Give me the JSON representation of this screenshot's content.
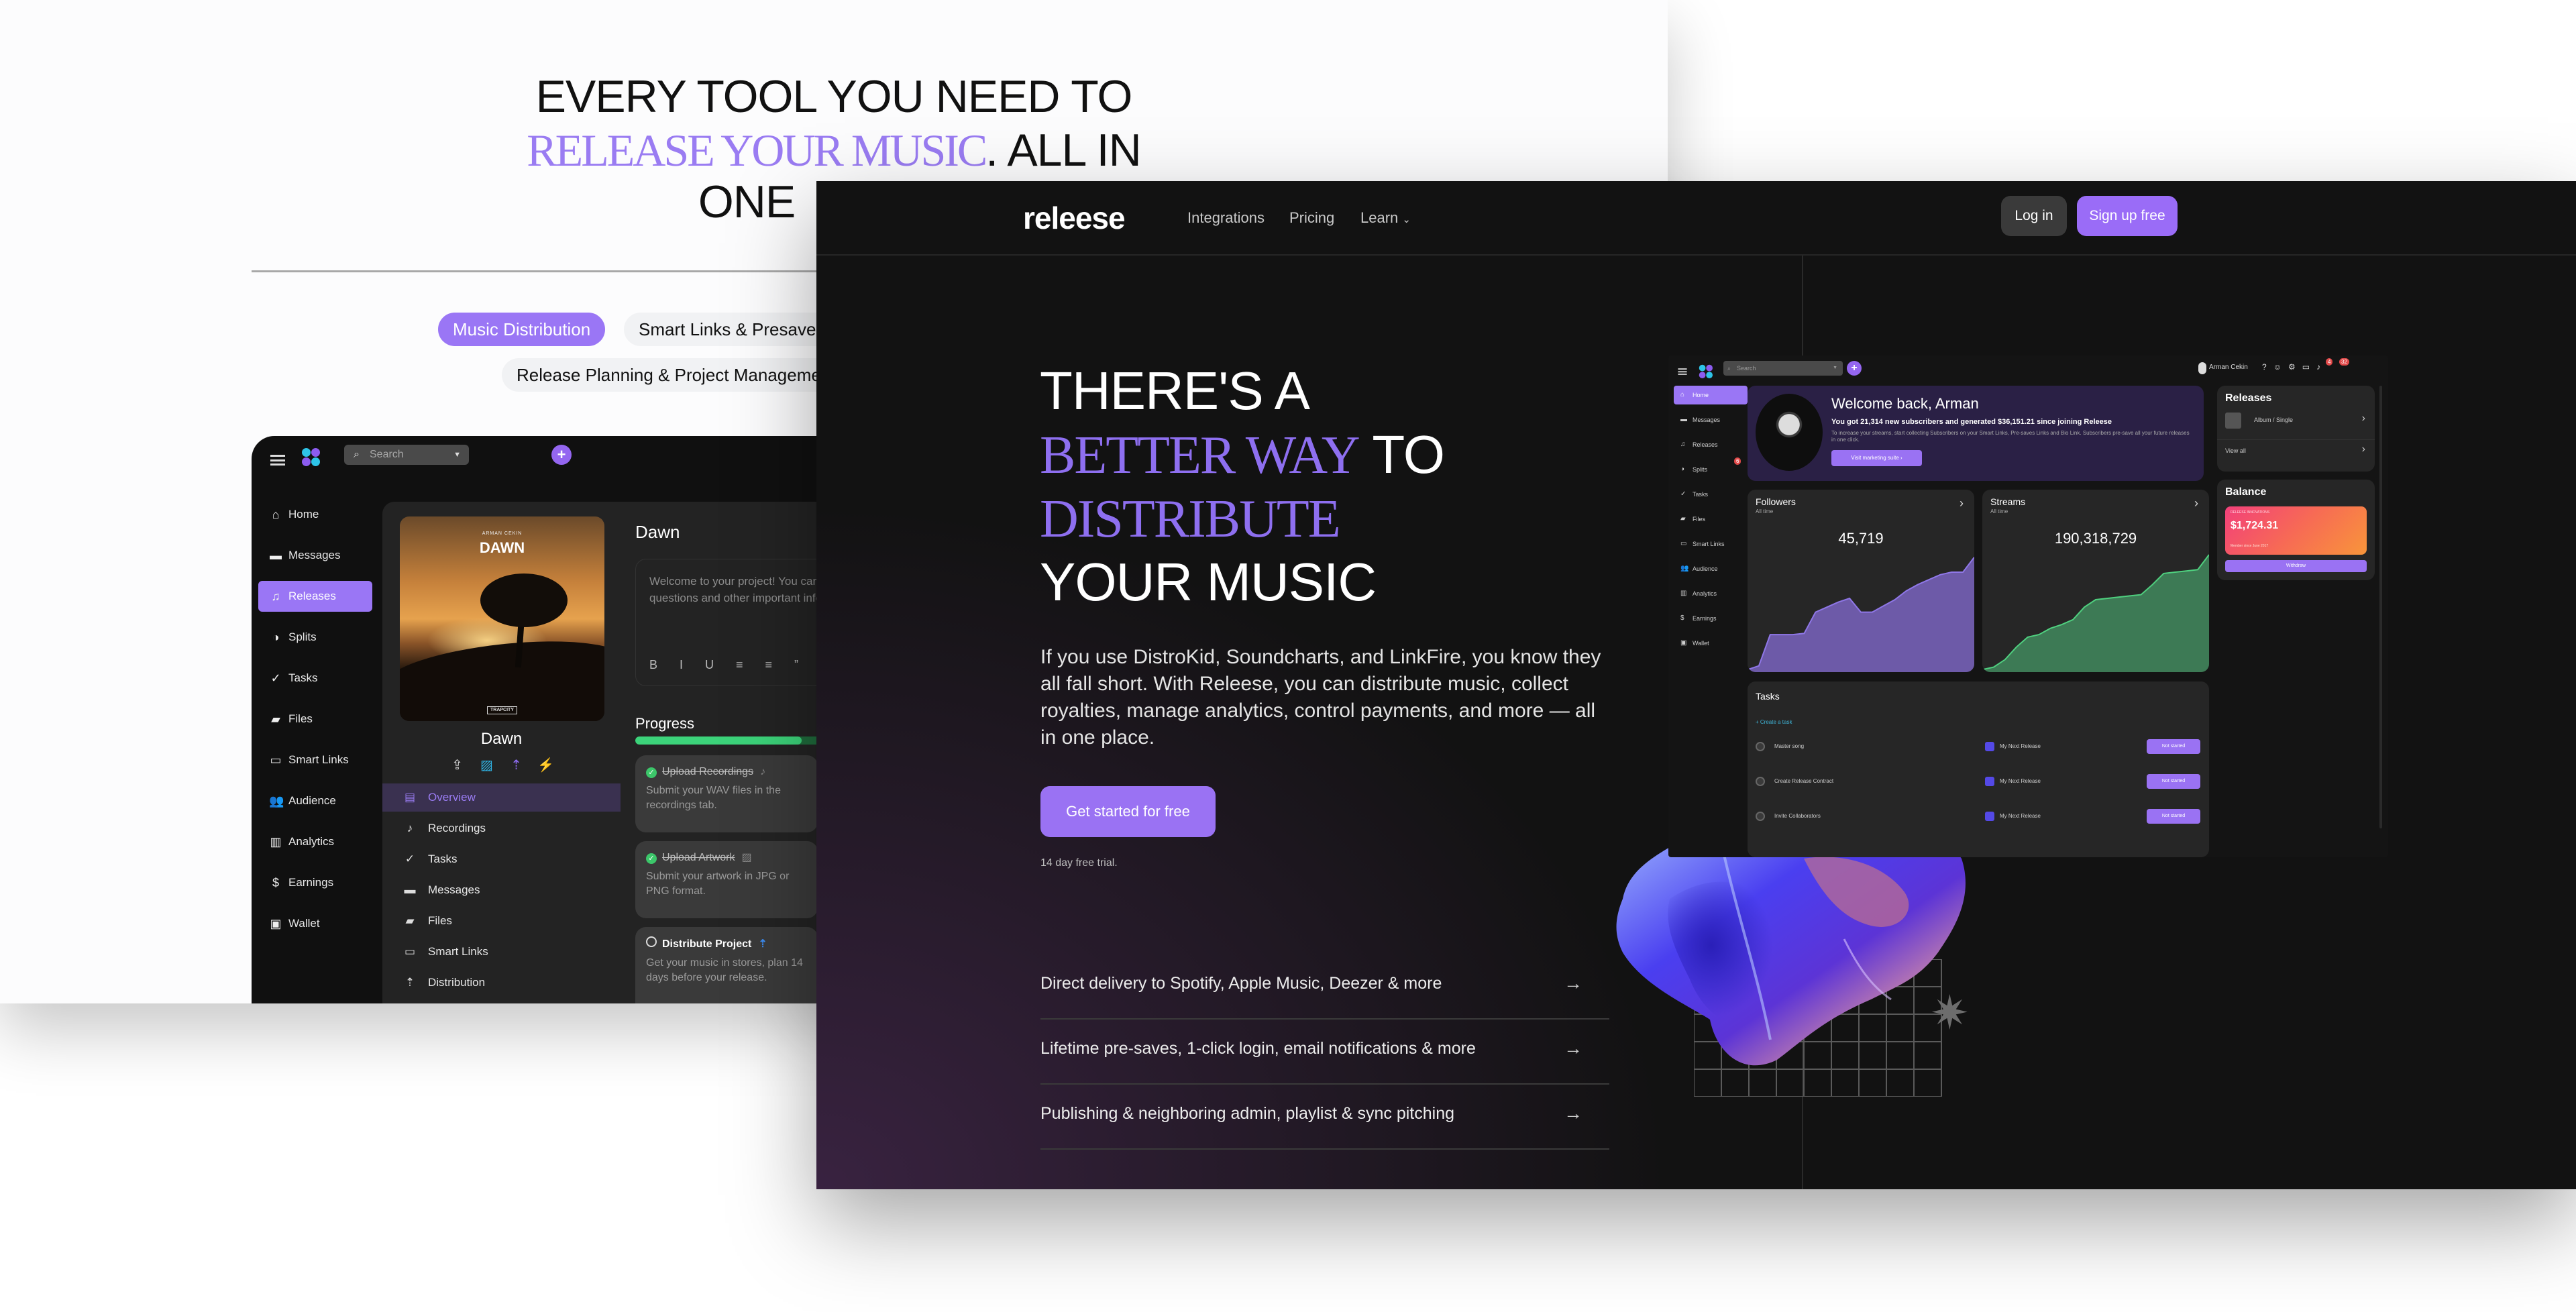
{
  "white_page": {
    "heading_line1": "EVERY TOOL YOU NEED TO",
    "heading_accent": "RELEASE YOUR MUSIC",
    "heading_line2_rest": ". ALL IN",
    "heading_line3": "ONE",
    "pills": [
      {
        "label": "Music Distribution",
        "active": true
      },
      {
        "label": "Smart Links & Presaves",
        "active": false
      },
      {
        "label": "Release Planning & Project Management",
        "active": false
      }
    ],
    "app": {
      "search_placeholder": "Search",
      "sidebar": [
        {
          "label": "Home",
          "icon": "home-icon",
          "glyph": "⌂"
        },
        {
          "label": "Messages",
          "icon": "message-icon",
          "glyph": "▬"
        },
        {
          "label": "Releases",
          "icon": "releases-icon",
          "glyph": "♫",
          "active": true
        },
        {
          "label": "Splits",
          "icon": "pie-chart-icon",
          "glyph": "◑"
        },
        {
          "label": "Tasks",
          "icon": "check-circle-icon",
          "glyph": "✓"
        },
        {
          "label": "Files",
          "icon": "folder-icon",
          "glyph": "▰"
        },
        {
          "label": "Smart Links",
          "icon": "devices-icon",
          "glyph": "▭"
        },
        {
          "label": "Audience",
          "icon": "people-icon",
          "glyph": "👥"
        },
        {
          "label": "Analytics",
          "icon": "analytics-icon",
          "glyph": "▥"
        },
        {
          "label": "Earnings",
          "icon": "dollar-icon",
          "glyph": "$"
        },
        {
          "label": "Wallet",
          "icon": "wallet-icon",
          "glyph": "▣"
        }
      ],
      "cover": {
        "artist": "ARMAN CEKIN",
        "title": "DAWN",
        "label": "TRAPCITY"
      },
      "release_title": "Dawn",
      "actions": [
        {
          "icon": "share-icon",
          "glyph": "⇪",
          "color": "#dddddd"
        },
        {
          "icon": "add-image-icon",
          "glyph": "▨",
          "color": "#2fb6e8"
        },
        {
          "icon": "upload-icon",
          "glyph": "⇡",
          "color": "#8f6cf2"
        },
        {
          "icon": "sparkle-chart-icon",
          "glyph": "⚡",
          "color": "#3d8bf0"
        }
      ],
      "release_nav": [
        {
          "label": "Overview",
          "icon": "overview-icon",
          "glyph": "▤",
          "active": true
        },
        {
          "label": "Recordings",
          "icon": "music-note-icon",
          "glyph": "♪"
        },
        {
          "label": "Tasks",
          "icon": "check-circle-icon",
          "glyph": "✓"
        },
        {
          "label": "Messages",
          "icon": "chat-icon",
          "glyph": "▬"
        },
        {
          "label": "Files",
          "icon": "folder-icon",
          "glyph": "▰"
        },
        {
          "label": "Smart Links",
          "icon": "devices-icon",
          "glyph": "▭"
        },
        {
          "label": "Distribution",
          "icon": "upload-icon",
          "glyph": "⇡"
        }
      ],
      "detail": {
        "title": "Dawn",
        "editor_text": "Welcome to your project! You can leave notes, questions and other important info here.",
        "toolbar": "B I U ≡ ≡ ” ≡",
        "progress_label": "Progress",
        "progress_fraction": 0.62,
        "tasks": [
          {
            "title": "Upload Recordings",
            "done": true,
            "desc": "Submit your WAV files in the recordings tab.",
            "icon": "♪"
          },
          {
            "title": "Upload Artwork",
            "done": true,
            "desc": "Submit your artwork in JPG or PNG format.",
            "icon": "▨"
          },
          {
            "title": "Distribute Project",
            "done": false,
            "desc": "Get your music in stores, plan 14 days before your release.",
            "icon": "⇡"
          }
        ]
      }
    }
  },
  "dark_page": {
    "brand": "releese",
    "nav": [
      "Integrations",
      "Pricing",
      "Learn"
    ],
    "learn_caret": "⌄",
    "login": "Log in",
    "signup": "Sign up free",
    "hero": {
      "line1": "THERE'S A",
      "line2_accent": "BETTER WAY",
      "line2_rest": " TO",
      "line3_accent": "DISTRIBUTE",
      "line4": "YOUR MUSIC"
    },
    "paragraph": "If you use DistroKid, Soundcharts, and LinkFire, you know they all fall short. With Releese, you can distribute music, collect royalties, manage analytics, control payments, and more — all in one place.",
    "cta": "Get started for free",
    "trial": "14 day free trial.",
    "features": [
      "Direct delivery to Spotify, Apple Music, Deezer & more",
      "Lifetime pre-saves, 1-click login, email notifications & more",
      "Publishing & neighboring admin, playlist & sync pitching"
    ],
    "arrow": "→",
    "mini_dashboard": {
      "search_placeholder": "Search",
      "user_name": "Arman Cekin",
      "badges": {
        "messages": "4",
        "notifications": "32"
      },
      "sidebar": [
        {
          "label": "Home",
          "glyph": "⌂",
          "active": true
        },
        {
          "label": "Messages",
          "glyph": "▬"
        },
        {
          "label": "Releases",
          "glyph": "♫"
        },
        {
          "label": "Splits",
          "glyph": "◑",
          "badge": "6"
        },
        {
          "label": "Tasks",
          "glyph": "✓"
        },
        {
          "label": "Files",
          "glyph": "▰"
        },
        {
          "label": "Smart Links",
          "glyph": "▭"
        },
        {
          "label": "Audience",
          "glyph": "👥"
        },
        {
          "label": "Analytics",
          "glyph": "▥"
        },
        {
          "label": "Earnings",
          "glyph": "$"
        },
        {
          "label": "Wallet",
          "glyph": "▣"
        }
      ],
      "welcome": {
        "title": "Welcome back, Arman",
        "subtitle": "You got 21,314 new subscribers and generated $36,151.21 since joining Releese",
        "body": "To increase your streams, start collecting Subscribers on your Smart Links, Pre-saves Links and Bio Link. Subscribers pre-save all your future releases in one click.",
        "button": "Visit marketing suite"
      },
      "followers": {
        "title": "Followers",
        "period": "All time",
        "value": "45,719"
      },
      "streams": {
        "title": "Streams",
        "period": "All time",
        "value": "190,318,729"
      },
      "releases": {
        "title": "Releases",
        "item": "Album / Single",
        "view_all": "View all"
      },
      "balance": {
        "title": "Balance",
        "company": "RELEESE INNOVATIONS",
        "amount": "$1,724.31",
        "member_since": "Member since June 2017",
        "withdraw": "Withdraw"
      },
      "tasks": {
        "title": "Tasks",
        "create": "+ Create a task",
        "rows": [
          {
            "name": "Master song",
            "project": "My Next Release",
            "status": "Not started"
          },
          {
            "name": "Create Release Contract",
            "project": "My Next Release",
            "status": "Not started"
          },
          {
            "name": "Invite Collaborators",
            "project": "My Next Release",
            "status": "Not started"
          }
        ]
      }
    }
  },
  "chart_data": [
    {
      "type": "area",
      "title": "Followers",
      "subtitle": "All time",
      "x": [
        0,
        1,
        2,
        3,
        4,
        5,
        6,
        7,
        8,
        9,
        10,
        11,
        12,
        13,
        14,
        15,
        16,
        17,
        18,
        19,
        20
      ],
      "values": [
        0.02,
        0.05,
        0.3,
        0.3,
        0.3,
        0.31,
        0.48,
        0.52,
        0.56,
        0.59,
        0.48,
        0.48,
        0.53,
        0.58,
        0.65,
        0.7,
        0.74,
        0.78,
        0.8,
        0.8,
        0.92
      ],
      "color": "#6d5aa8",
      "line_color": "#8f77e8"
    },
    {
      "type": "area",
      "title": "Streams",
      "subtitle": "All time",
      "x": [
        0,
        1,
        2,
        3,
        4,
        5,
        6,
        7,
        8,
        9,
        10,
        11,
        12,
        13,
        14,
        15,
        16,
        17,
        18,
        19,
        20
      ],
      "values": [
        0.02,
        0.04,
        0.1,
        0.2,
        0.28,
        0.3,
        0.35,
        0.38,
        0.42,
        0.52,
        0.58,
        0.59,
        0.6,
        0.61,
        0.62,
        0.7,
        0.79,
        0.8,
        0.81,
        0.82,
        0.94
      ],
      "color": "#3d7a55",
      "line_color": "#4fd07f"
    }
  ]
}
